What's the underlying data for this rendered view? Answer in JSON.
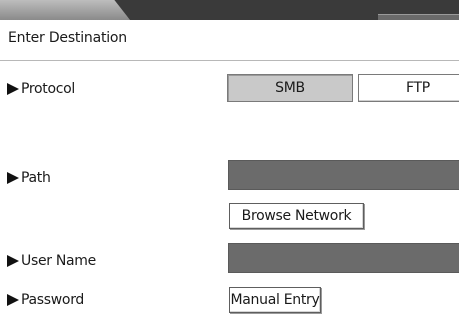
{
  "dialog": {
    "title": "Enter Destination"
  },
  "protocol": {
    "label": "Protocol",
    "options": [
      "SMB",
      "FTP"
    ],
    "selected": "SMB"
  },
  "path": {
    "label": "Path",
    "value": "",
    "browse_button": "Browse Network"
  },
  "user_name": {
    "label": "User Name",
    "value": ""
  },
  "password": {
    "label": "Password",
    "manual_entry_button": "Manual Entry"
  },
  "colors": {
    "field_fill": "#6b6b6b",
    "selected_button": "#c9c9c9",
    "top_strip": "#3a3a3a"
  },
  "icons": {
    "row_marker": "triangle-right-icon"
  }
}
